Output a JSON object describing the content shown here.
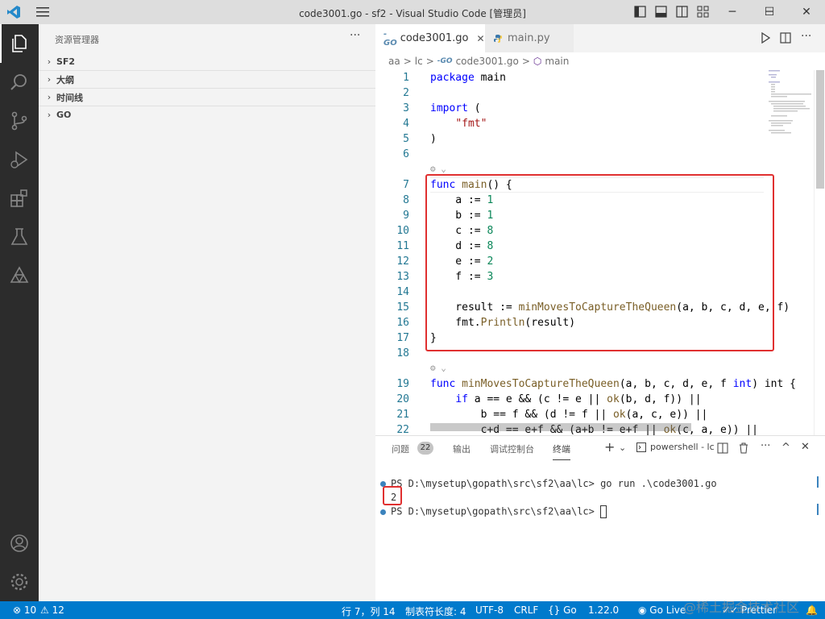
{
  "window": {
    "title": "code3001.go - sf2 - Visual Studio Code [管理员]",
    "controls": [
      "─",
      "☐",
      "✕"
    ]
  },
  "activity_bar": {
    "items": [
      "explorer-icon",
      "search-icon",
      "source-control-icon",
      "run-debug-icon",
      "extensions-icon",
      "testing-icon",
      "remote-icon"
    ],
    "bottom": [
      "account-icon",
      "settings-gear-icon"
    ]
  },
  "sidebar": {
    "title": "资源管理器",
    "more": "···",
    "sections": [
      "SF2",
      "大纲",
      "时间线",
      "GO"
    ]
  },
  "tabs": [
    {
      "icon": "-GO",
      "label": "code3001.go",
      "close": "✕"
    },
    {
      "icon": "python-icon",
      "label": "main.py"
    }
  ],
  "breadcrumb": [
    "aa",
    ">",
    "lc",
    ">",
    "-GO",
    "code3001.go",
    ">",
    "main"
  ],
  "editor": {
    "lines": [
      {
        "n": "1",
        "parts": [
          [
            "kw",
            "package"
          ],
          [
            "",
            " main"
          ]
        ]
      },
      {
        "n": "2",
        "parts": []
      },
      {
        "n": "3",
        "parts": [
          [
            "kw",
            "import"
          ],
          [
            "",
            " ("
          ]
        ]
      },
      {
        "n": "4",
        "parts": [
          [
            "",
            "    "
          ],
          [
            "str",
            "\"fmt\""
          ]
        ]
      },
      {
        "n": "5",
        "parts": [
          [
            "",
            ")"
          ]
        ]
      },
      {
        "n": "6",
        "parts": []
      },
      {
        "n": "7",
        "parts": [
          [
            "kw",
            "func"
          ],
          [
            "",
            " "
          ],
          [
            "fn",
            "main"
          ],
          [
            "",
            "() {"
          ]
        ]
      },
      {
        "n": "8",
        "parts": [
          [
            "",
            "    a := "
          ],
          [
            "num",
            "1"
          ]
        ]
      },
      {
        "n": "9",
        "parts": [
          [
            "",
            "    b := "
          ],
          [
            "num",
            "1"
          ]
        ]
      },
      {
        "n": "10",
        "parts": [
          [
            "",
            "    c := "
          ],
          [
            "num",
            "8"
          ]
        ]
      },
      {
        "n": "11",
        "parts": [
          [
            "",
            "    d := "
          ],
          [
            "num",
            "8"
          ]
        ]
      },
      {
        "n": "12",
        "parts": [
          [
            "",
            "    e := "
          ],
          [
            "num",
            "2"
          ]
        ]
      },
      {
        "n": "13",
        "parts": [
          [
            "",
            "    f := "
          ],
          [
            "num",
            "3"
          ]
        ]
      },
      {
        "n": "14",
        "parts": []
      },
      {
        "n": "15",
        "parts": [
          [
            "",
            "    result := "
          ],
          [
            "fn",
            "minMovesToCaptureTheQueen"
          ],
          [
            "",
            "(a, b, c, d, e, f)"
          ]
        ]
      },
      {
        "n": "16",
        "parts": [
          [
            "",
            "    fmt."
          ],
          [
            "fn",
            "Println"
          ],
          [
            "",
            "(result)"
          ]
        ]
      },
      {
        "n": "17",
        "parts": [
          [
            "",
            "}"
          ]
        ]
      },
      {
        "n": "18",
        "parts": []
      },
      {
        "n": "19",
        "parts": [
          [
            "kw",
            "func"
          ],
          [
            "",
            " "
          ],
          [
            "fn",
            "minMovesToCaptureTheQueen"
          ],
          [
            "",
            "(a, b, c, d, e, f "
          ],
          [
            "kw",
            "int"
          ],
          [
            "",
            ") int {"
          ]
        ]
      },
      {
        "n": "20",
        "parts": [
          [
            "",
            "    "
          ],
          [
            "kw",
            "if"
          ],
          [
            "",
            " a == e && (c != e || "
          ],
          [
            "fn",
            "ok"
          ],
          [
            "",
            "(b, d, f)) ||"
          ]
        ]
      },
      {
        "n": "21",
        "parts": [
          [
            "",
            "        b == f && (d != f || "
          ],
          [
            "fn",
            "ok"
          ],
          [
            "",
            "(a, c, e)) ||"
          ]
        ]
      },
      {
        "n": "22",
        "parts": [
          [
            "",
            "        c+d == e+f && (a+b != e+f || "
          ],
          [
            "fn",
            "ok"
          ],
          [
            "",
            "(c, a, e)) ||"
          ]
        ]
      }
    ],
    "code_lens": "⚙ ⌄"
  },
  "panel": {
    "tabs": [
      "问题",
      "输出",
      "调试控制台",
      "终端"
    ],
    "problems_count": "22",
    "actions": [
      "+",
      "⌄",
      "powershell - lc",
      "split-icon",
      "trash-icon",
      "···",
      "^",
      "✕"
    ],
    "terminal": [
      "PS D:\\mysetup\\gopath\\src\\sf2\\aa\\lc> go run .\\code3001.go",
      "2",
      "PS D:\\mysetup\\gopath\\src\\sf2\\aa\\lc> "
    ]
  },
  "statusbar": {
    "errors": "⊗ 10",
    "warnings": "⚠ 12",
    "position": "行 7，列 14",
    "tab_size": "制表符长度: 4",
    "encoding": "UTF-8",
    "eol": "CRLF",
    "lang": "{} Go",
    "version": "1.22.0",
    "golive": "Go Live",
    "prettier": "Prettier",
    "watermark": "@稀土掘金技术社区"
  },
  "colors": {
    "accent": "#007acc",
    "highlight_box": "#e03030"
  }
}
